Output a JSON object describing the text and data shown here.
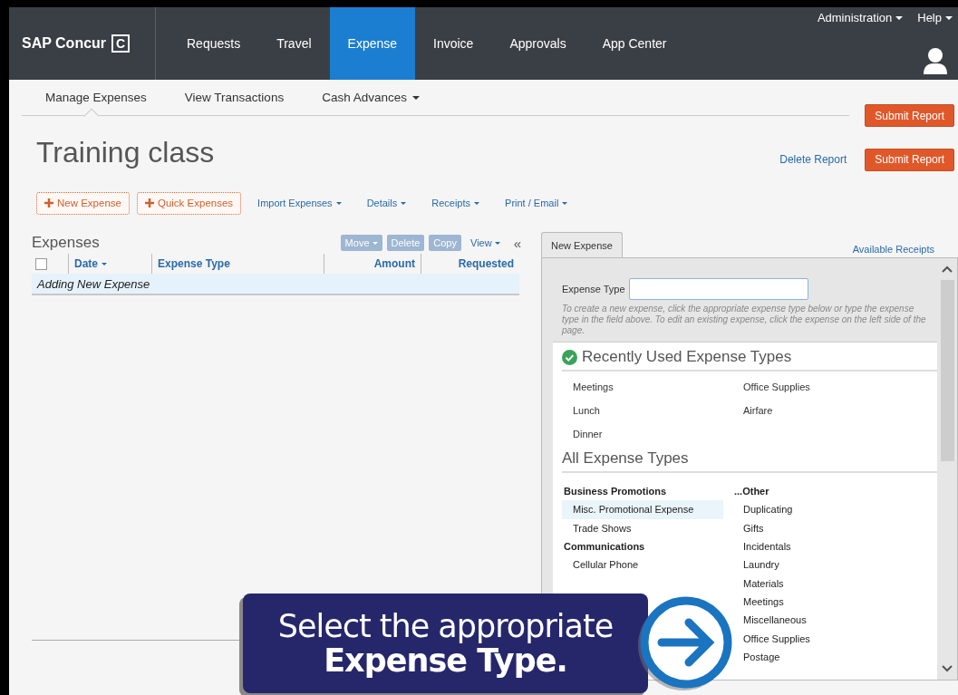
{
  "nav": {
    "logo": "SAP Concur",
    "logo_mark": "C",
    "items": [
      {
        "label": "Requests",
        "selected": false
      },
      {
        "label": "Travel",
        "selected": false
      },
      {
        "label": "Expense",
        "selected": true
      },
      {
        "label": "Invoice",
        "selected": false
      },
      {
        "label": "Approvals",
        "selected": false
      },
      {
        "label": "App Center",
        "selected": false
      }
    ],
    "utility": [
      "Administration",
      "Help"
    ]
  },
  "subnav": {
    "items": [
      {
        "label": "Manage Expenses",
        "selected": true,
        "dropdown": false
      },
      {
        "label": "View Transactions",
        "selected": false,
        "dropdown": false
      },
      {
        "label": "Cash Advances",
        "selected": false,
        "dropdown": true
      }
    ]
  },
  "floating_button": "Submit Report",
  "report": {
    "title": "Training class",
    "delete_link": "Delete Report",
    "submit": "Submit Report"
  },
  "toolbar": [
    {
      "kind": "add",
      "label": "New Expense"
    },
    {
      "kind": "add",
      "label": "Quick Expenses"
    },
    {
      "kind": "menu",
      "label": "Import Expenses"
    },
    {
      "kind": "menu",
      "label": "Details"
    },
    {
      "kind": "menu",
      "label": "Receipts"
    },
    {
      "kind": "menu",
      "label": "Print / Email"
    }
  ],
  "expenses": {
    "title": "Expenses",
    "actions": [
      {
        "label": "Move",
        "disabled": true,
        "dropdown": true
      },
      {
        "label": "Delete",
        "disabled": true,
        "dropdown": false
      },
      {
        "label": "Copy",
        "disabled": true,
        "dropdown": false
      },
      {
        "label": "View",
        "disabled": false,
        "dropdown": true
      }
    ],
    "collapse": "«",
    "select_all": {
      "checked": false
    },
    "columns": [
      {
        "label": "Date",
        "sort": true
      },
      {
        "label": "Expense Type",
        "sort": false
      },
      {
        "label": "Amount",
        "sort": false
      },
      {
        "label": "Requested",
        "sort": false
      }
    ],
    "rows": [
      {
        "text": "Adding New Expense",
        "selected": true
      }
    ]
  },
  "panel": {
    "tab": {
      "label": "New Expense",
      "selected": true
    },
    "link": "Available Receipts",
    "field_label": "Expense Type",
    "hint": "To create a new expense, click the appropriate expense type below or type the expense type in the field above. To edit an existing expense, click the expense on the left side of the page.",
    "recent_title": "Recently Used Expense Types",
    "recent": [
      "Meetings",
      "Office Supplies",
      "Lunch",
      "Airfare",
      "Dinner"
    ],
    "all_title": "All Expense Types",
    "columns": [
      [
        {
          "kind": "group",
          "label": "Business Promotions",
          "selected": false
        },
        {
          "kind": "item",
          "label": "Misc. Promotional Expense",
          "selected": true
        },
        {
          "kind": "item",
          "label": "Trade Shows",
          "selected": false
        },
        {
          "kind": "group",
          "label": "Communications",
          "selected": false
        },
        {
          "kind": "item",
          "label": "Cellular Phone",
          "selected": false
        }
      ],
      [
        {
          "kind": "group",
          "label": "...Other",
          "selected": false
        },
        {
          "kind": "item",
          "label": "Duplicating",
          "selected": false
        },
        {
          "kind": "item",
          "label": "Gifts",
          "selected": false
        },
        {
          "kind": "item",
          "label": "Incidentals",
          "selected": false
        },
        {
          "kind": "item",
          "label": "Laundry",
          "selected": false
        },
        {
          "kind": "item",
          "label": "Materials",
          "selected": false
        },
        {
          "kind": "item",
          "label": "Meetings",
          "selected": false
        },
        {
          "kind": "item",
          "label": "Miscellaneous",
          "selected": false
        },
        {
          "kind": "item",
          "label": "Office Supplies",
          "selected": false
        },
        {
          "kind": "item",
          "label": "Postage",
          "selected": false
        }
      ]
    ]
  },
  "callout": {
    "lines": [
      {
        "text": "Select the appropriate",
        "bold": false
      },
      {
        "text": "Expense Type.",
        "bold": true
      }
    ]
  }
}
